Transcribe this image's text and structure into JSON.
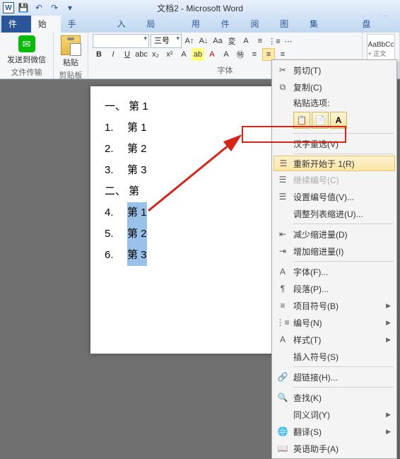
{
  "app": {
    "title": "文档2 - Microsoft Word"
  },
  "qat": {
    "save": "保存",
    "undo": "撤销",
    "redo": "恢复"
  },
  "tabs": {
    "file": "文件",
    "home": "开始",
    "office": "Office助手",
    "insert": "插入",
    "layout": "页面布局",
    "ref": "引用",
    "mail": "邮件",
    "review": "审阅",
    "view": "视图",
    "pdf": "PDF工具集",
    "baidu": "百度网盘"
  },
  "ribbon": {
    "wechat_group": "文件传输",
    "wechat_label": "发送到微信",
    "clipboard_group": "剪贴板",
    "paste_label": "粘贴",
    "font_group": "字体",
    "font_name": "",
    "font_size": "三号",
    "style_sample": "AaBbCc",
    "style_label": "+ 正文"
  },
  "doc": {
    "h1": "一、 第 1",
    "i1_num": "1.",
    "i1_txt": "第 1 ",
    "i2_num": "2.",
    "i2_txt": "第 2 ",
    "i3_num": "3.",
    "i3_txt": "第 3 ",
    "h2": "二、 第",
    "i4_num": "4.",
    "i4_txt": "第 1",
    "i5_num": "5.",
    "i5_txt": "第 2",
    "i6_num": "6.",
    "i6_txt": "第 3"
  },
  "menu": {
    "cut": "剪切(T)",
    "copy": "复制(C)",
    "paste_opts": "粘贴选项:",
    "hanzi": "汉字重选(V)",
    "restart": "重新开始于 1(R)",
    "continue": "继续编号(C)",
    "setnum": "设置编号值(V)...",
    "adjust": "调整列表缩进(U)...",
    "decrease": "减少缩进量(D)",
    "increase": "增加缩进量(I)",
    "font": "字体(F)...",
    "paragraph": "段落(P)...",
    "bullets": "项目符号(B)",
    "numbering": "编号(N)",
    "styles": "样式(T)",
    "symbol": "插入符号(S)",
    "hyperlink": "超链接(H)...",
    "lookup": "查找(K)",
    "synonym": "同义词(Y)",
    "translate": "翻译(S)",
    "assist": "英语助手(A)"
  }
}
